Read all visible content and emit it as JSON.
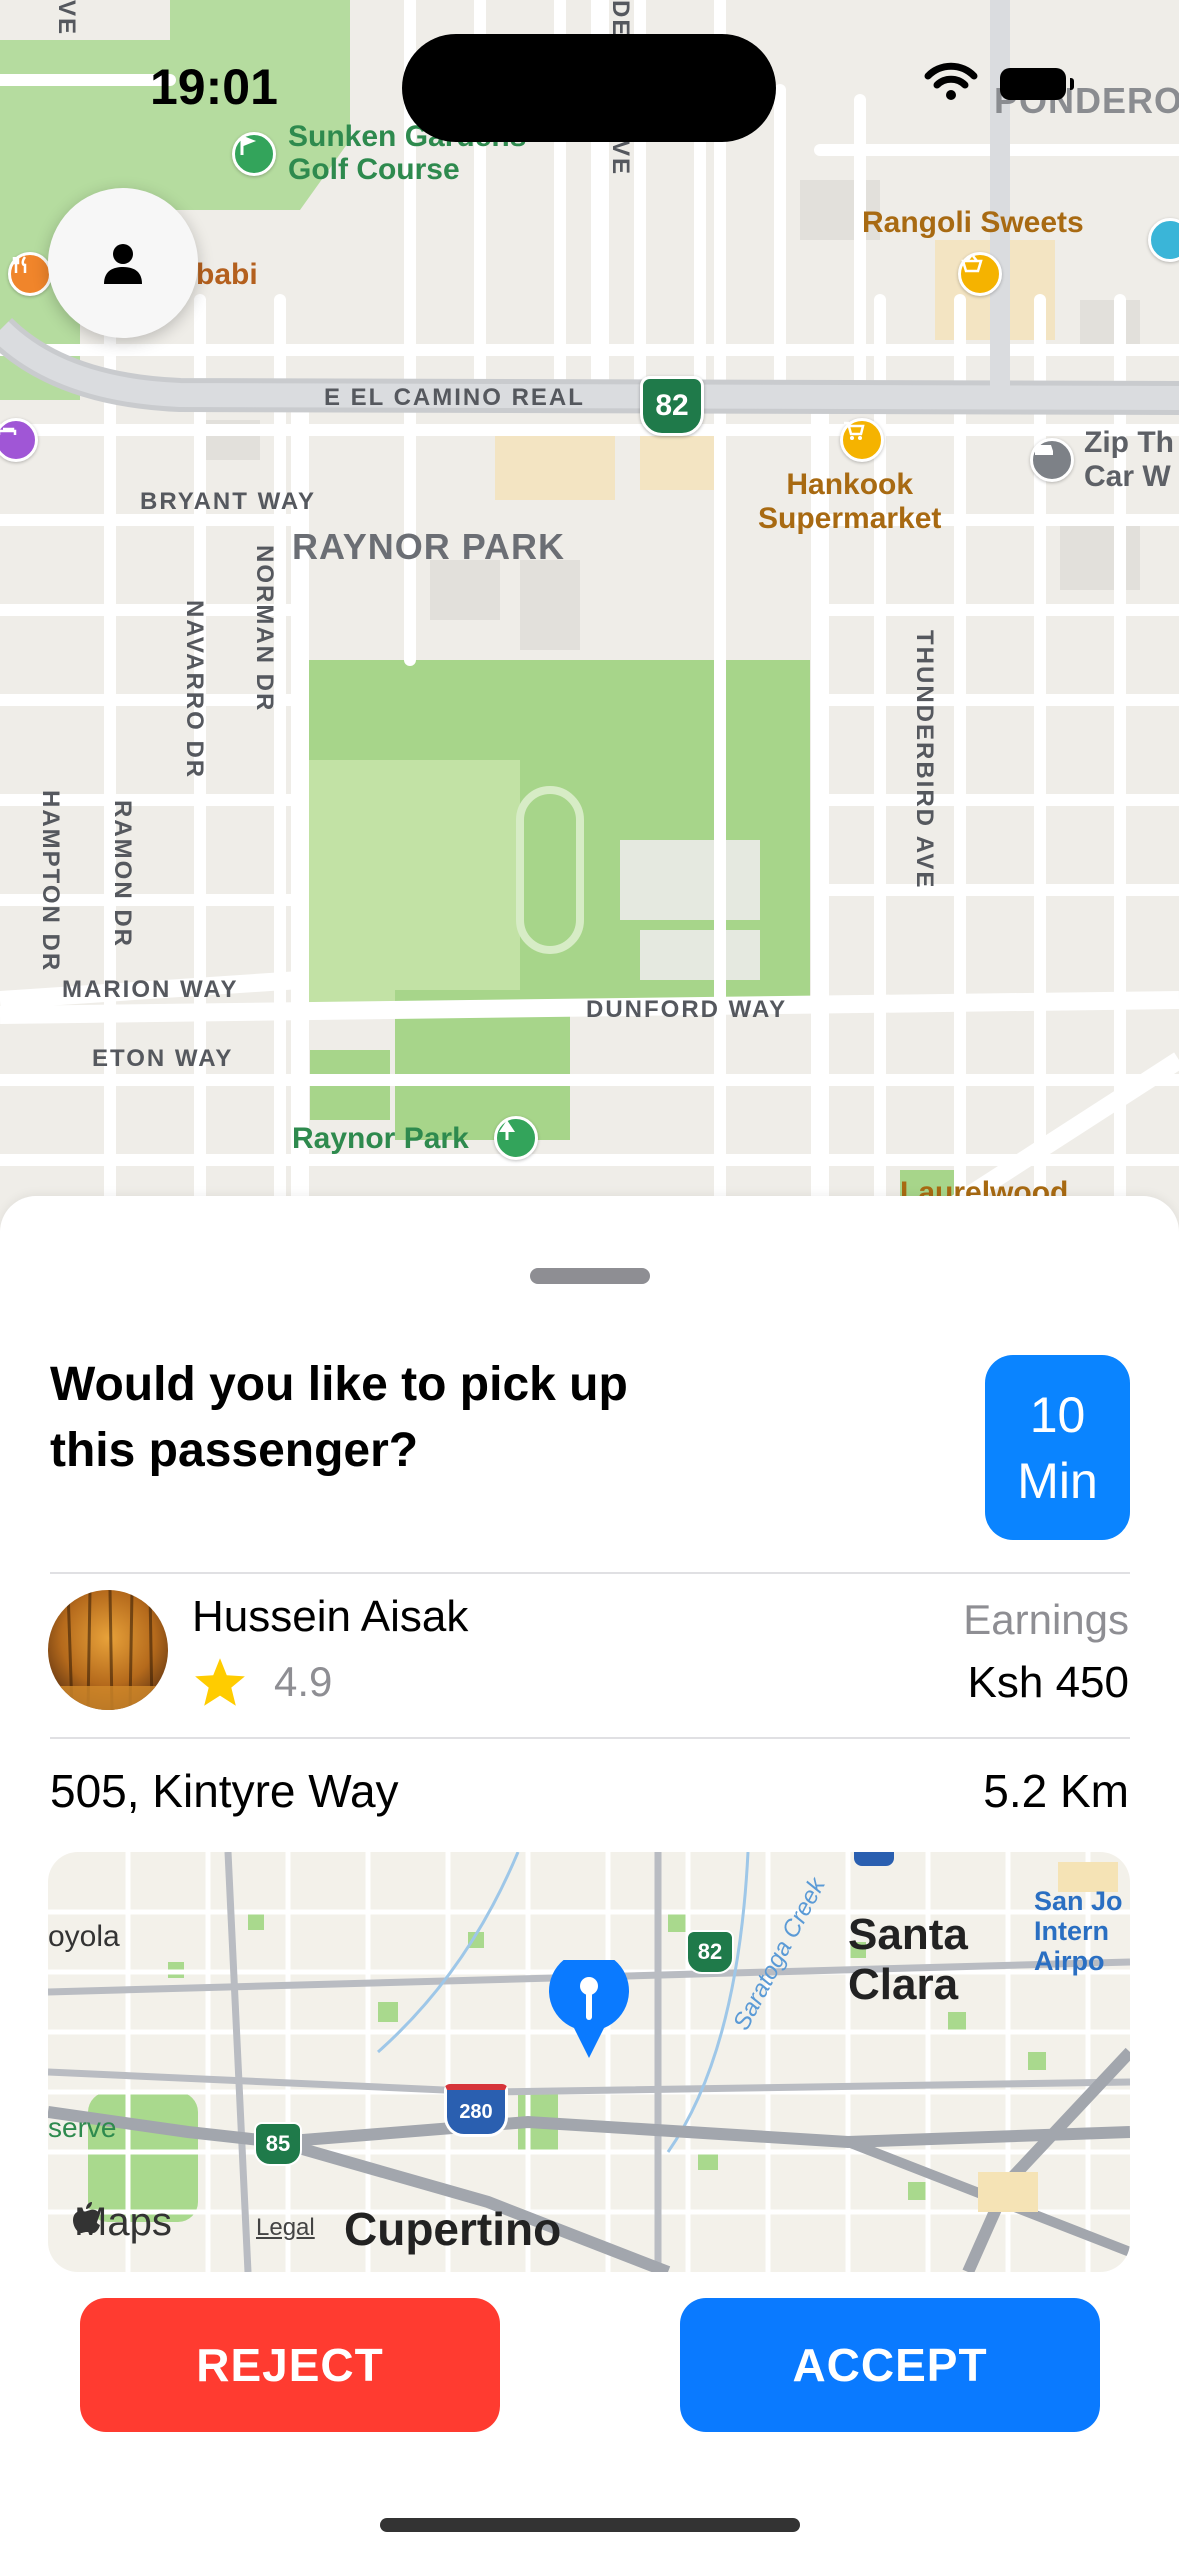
{
  "status_bar": {
    "time": "19:01"
  },
  "map": {
    "streets": {
      "el_camino": "E EL CAMINO REAL",
      "bryant": "BRYANT WAY",
      "norman": "NORMAN DR",
      "navarro": "NAVARRO DR",
      "hampton": "HAMPTON DR",
      "ramon": "RAMON DR",
      "marion": "MARION WAY",
      "eton": "ETON WAY",
      "dunford": "DUNFORD WAY",
      "thunderbird": "THUNDERBIRD AVE",
      "top_left": "VE",
      "top_mid_1": "DE",
      "top_mid_2": "VE"
    },
    "areas": {
      "raynor_park": "RAYNOR PARK",
      "ponderosa": "PONDEROS"
    },
    "pois": {
      "golf_1": "Sunken Gardens",
      "golf_2": "Golf Course",
      "restaurant": "babi",
      "rangoli": "Rangoli Sweets",
      "hankook_1": "Hankook",
      "hankook_2": "Supermarket",
      "zip_1": "Zip Th",
      "zip_2": "Car W",
      "raynor_park_poi": "Raynor Park",
      "laurelwood": "Laurelwood"
    },
    "route_shield": "82"
  },
  "request": {
    "question": "Would you like to pick up this passenger?",
    "eta_value": "10",
    "eta_unit": "Min"
  },
  "passenger": {
    "name": "Hussein Aisak",
    "rating": "4.9",
    "earnings_label": "Earnings",
    "earnings_value": "Ksh 450"
  },
  "trip": {
    "address": "505, Kintyre Way",
    "distance": "5.2 Km"
  },
  "mini_map": {
    "santa_clara_1": "Santa",
    "santa_clara_2": "Clara",
    "san_jose_1": "San Jo",
    "san_jose_2": "Intern",
    "san_jose_3": "Airpo",
    "cupertino": "Cupertino",
    "oyola": "oyola",
    "serve": "serve",
    "saratoga": "Saratoga Creek",
    "shield_82": "82",
    "shield_85": "85",
    "shield_280": "280",
    "maps_brand": "Maps",
    "legal": "Legal"
  },
  "actions": {
    "reject": "REJECT",
    "accept": "ACCEPT"
  },
  "colors": {
    "accent": "#0a84ff",
    "reject": "#ff3b30",
    "star": "#ffcc00",
    "park_green": "#a7d58a"
  }
}
